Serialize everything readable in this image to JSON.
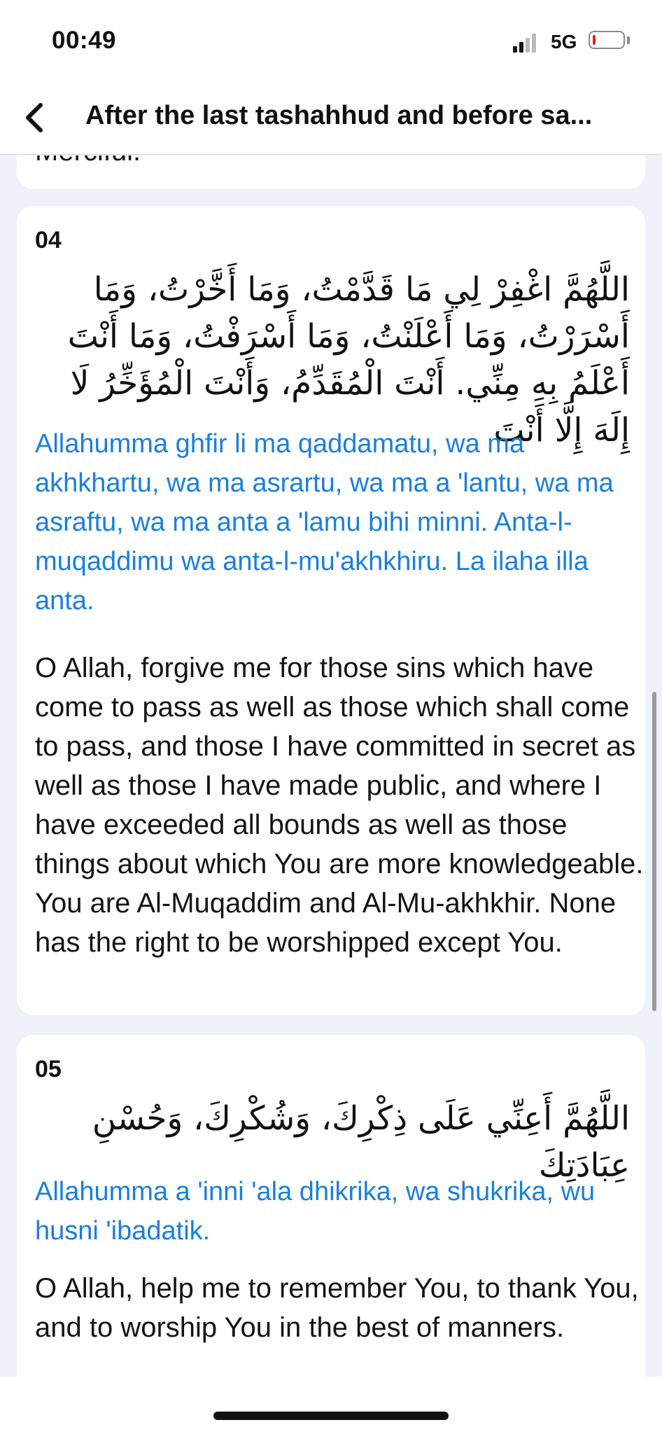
{
  "status_bar": {
    "time": "00:49",
    "network": "5G"
  },
  "nav": {
    "title": "After the last tashahhud and before sa..."
  },
  "previous_card": {
    "tail_text": "Merciful."
  },
  "cards": [
    {
      "number": "04",
      "arabic": "اللَّهُمَّ اغْفِرْ لِي مَا قَدَّمْتُ، وَمَا أَخَّرْتُ، وَمَا أَسْرَرْتُ، وَمَا أَعْلَنْتُ، وَمَا أَسْرَفْتُ، وَمَا أَنْتَ أَعْلَمُ بِهِ مِنِّي. أَنْتَ الْمُقَدِّمُ، وَأَنْتَ الْمُؤَخِّرُ لَا إِلَهَ إِلَّا أَنْتَ",
      "transliteration": "Allahumma ghfir li ma qaddamatu, wa ma akhkhartu, wa ma asrartu, wa ma a 'lantu, wa ma asraftu, wa ma anta a 'lamu bihi minni. Anta-l-muqaddimu wa anta-l-mu'akhkhiru. La ilaha illa anta.",
      "translation": "O Allah, forgive me for those sins which have come to pass as well as those which shall come to pass, and those I have committed in secret as well as those I have made public, and where I have exceeded all bounds as well as those things about which You are more knowledgeable. You are Al-Muqaddim and Al-Mu-akhkhir. None has the right to be worshipped except You."
    },
    {
      "number": "05",
      "arabic": "اللَّهُمَّ أَعِنِّي عَلَى ذِكْرِكَ، وَشُكْرِكَ، وَحُسْنِ عِبَادَتِكَ",
      "transliteration": "Allahumma a 'inni 'ala dhikrika, wa shukrika, wu husni 'ibadatik.",
      "translation": "O Allah, help me to remember You, to thank You, and to worship You in the best of manners."
    }
  ],
  "colors": {
    "accent": "#1a7fdc",
    "background": "#eef2f8",
    "card": "#ffffff",
    "battery_low": "#e02020"
  }
}
